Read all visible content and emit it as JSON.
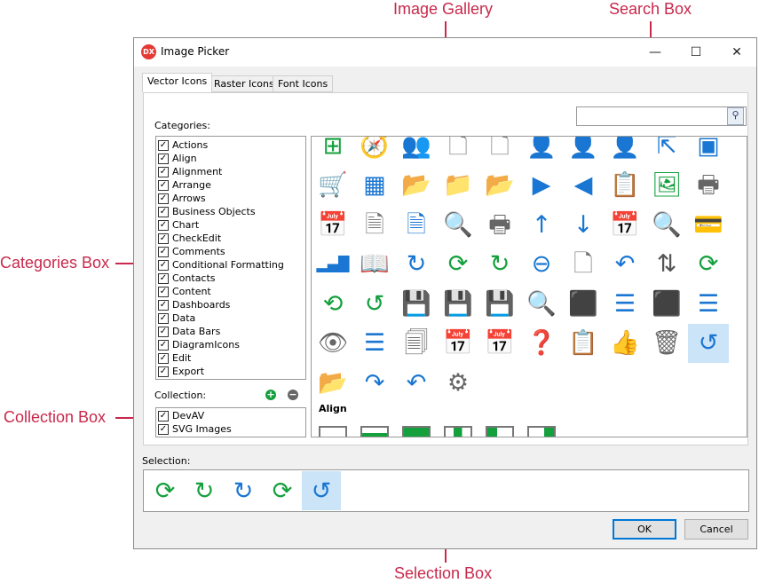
{
  "annotations": {
    "gallery": "Image Gallery",
    "search": "Search Box",
    "categories": "Categories Box",
    "collection": "Collection Box",
    "selection": "Selection Box",
    "color": "#c8294c"
  },
  "window": {
    "title": "Image Picker",
    "logo": "DX",
    "minimize": "—",
    "maximize": "☐",
    "close": "✕"
  },
  "tabs": [
    {
      "label": "Vector Icons",
      "active": true
    },
    {
      "label": "Raster Icons"
    },
    {
      "label": "Font Icons"
    }
  ],
  "categories_label": "Categories:",
  "categories": [
    "Actions",
    "Align",
    "Alignment",
    "Arrange",
    "Arrows",
    "Business Objects",
    "Chart",
    "CheckEdit",
    "Comments",
    "Conditional Formatting",
    "Contacts",
    "Content",
    "Dashboards",
    "Data",
    "Data Bars",
    "DiagramIcons",
    "Edit",
    "Export"
  ],
  "collection_label": "Collection:",
  "collection": [
    "DevAV",
    "SVG Images"
  ],
  "search": {
    "value": "",
    "icon": "magnifier-icon"
  },
  "gallery": {
    "icons": [
      {
        "name": "add-group-icon",
        "g": "⊞",
        "c": "#14a03c"
      },
      {
        "name": "compass-icon",
        "g": "🧭",
        "c": "#777"
      },
      {
        "name": "users-icon",
        "g": "👥",
        "c": "#777"
      },
      {
        "name": "blank-page-icon",
        "g": "🗋",
        "c": "#777"
      },
      {
        "name": "blank-page-icon",
        "g": "🗋",
        "c": "#777"
      },
      {
        "name": "add-user-icon",
        "g": "👤",
        "c": "#14a03c"
      },
      {
        "name": "user-icon",
        "g": "👤",
        "c": "#1976d2"
      },
      {
        "name": "user-more-icon",
        "g": "👤",
        "c": "#666"
      },
      {
        "name": "resize-picture-icon",
        "g": "⇱",
        "c": "#1976d2"
      },
      {
        "name": "add-window-icon",
        "g": "▣",
        "c": "#1976d2"
      },
      {
        "name": "add-to-cart-icon",
        "g": "🛒",
        "c": "#d32f2f"
      },
      {
        "name": "tiles-icon",
        "g": "▦",
        "c": "#1976d2"
      },
      {
        "name": "open-folder-icon",
        "g": "📂",
        "c": "#ffb300"
      },
      {
        "name": "folder-icon",
        "g": "📁",
        "c": "#ffb300"
      },
      {
        "name": "reload-folder-icon",
        "g": "📂",
        "c": "#ffb300"
      },
      {
        "name": "next-icon",
        "g": "▶",
        "c": "#1976d2"
      },
      {
        "name": "previous-icon",
        "g": "◀",
        "c": "#1976d2"
      },
      {
        "name": "paste-icon",
        "g": "📋",
        "c": "#ffb300"
      },
      {
        "name": "image-icon",
        "g": "🖼",
        "c": "#14a03c"
      },
      {
        "name": "printer-icon",
        "g": "🖶",
        "c": "#666"
      },
      {
        "name": "calendar-delete-icon",
        "g": "📅",
        "c": "#666"
      },
      {
        "name": "document-icon",
        "g": "🗎",
        "c": "#777"
      },
      {
        "name": "table-document-icon",
        "g": "🗎",
        "c": "#1976d2"
      },
      {
        "name": "zoom-page-icon",
        "g": "🔍",
        "c": "#777"
      },
      {
        "name": "quick-print-icon",
        "g": "🖶",
        "c": "#666"
      },
      {
        "name": "sort-ascending-icon",
        "g": "↑",
        "c": "#1976d2"
      },
      {
        "name": "sort-descending-icon",
        "g": "↓",
        "c": "#1976d2"
      },
      {
        "name": "calendar-clock-icon",
        "g": "📅",
        "c": "#666"
      },
      {
        "name": "preview-icon",
        "g": "🔍",
        "c": "#777"
      },
      {
        "name": "payment-icon",
        "g": "💳",
        "c": "#1976d2"
      },
      {
        "name": "bar-chart-icon",
        "g": "▂▄█",
        "c": "#1976d2"
      },
      {
        "name": "book-icon",
        "g": "📖",
        "c": "#777"
      },
      {
        "name": "redo-icon",
        "g": "↻",
        "c": "#1976d2"
      },
      {
        "name": "refresh-icon",
        "g": "⟳",
        "c": "#14a03c"
      },
      {
        "name": "refresh-all-icon",
        "g": "↻",
        "c": "#14a03c"
      },
      {
        "name": "remove-icon",
        "g": "⊖",
        "c": "#1976d2"
      },
      {
        "name": "remove-page-icon",
        "g": "🗋",
        "c": "#777"
      },
      {
        "name": "undo-icon",
        "g": "↶",
        "c": "#1976d2"
      },
      {
        "name": "swap-icon",
        "g": "⇅",
        "c": "#555"
      },
      {
        "name": "redo-green-icon",
        "g": "⟳",
        "c": "#14a03c"
      },
      {
        "name": "reset-icon",
        "g": "⟲",
        "c": "#14a03c"
      },
      {
        "name": "reset-all-icon",
        "g": "↺",
        "c": "#14a03c"
      },
      {
        "name": "save-icon",
        "g": "💾",
        "c": "#1976d2"
      },
      {
        "name": "save-close-icon",
        "g": "💾",
        "c": "#1976d2"
      },
      {
        "name": "save-more-icon",
        "g": "💾",
        "c": "#1976d2"
      },
      {
        "name": "find-icon",
        "g": "🔍",
        "c": "#1976d2"
      },
      {
        "name": "select-icon",
        "g": "⬛",
        "c": "#1976d2"
      },
      {
        "name": "select-all-icon",
        "g": "☰",
        "c": "#1976d2"
      },
      {
        "name": "select-icon",
        "g": "⬛",
        "c": "#1976d2"
      },
      {
        "name": "select-all-icon",
        "g": "☰",
        "c": "#1976d2"
      },
      {
        "name": "show-icon",
        "g": "👁",
        "c": "#666"
      },
      {
        "name": "list-icon",
        "g": "☰",
        "c": "#1976d2"
      },
      {
        "name": "sort-pages-icon",
        "g": "🗐",
        "c": "#666"
      },
      {
        "name": "calendar-down-icon",
        "g": "📅",
        "c": "#666"
      },
      {
        "name": "calendar-icon",
        "g": "📅",
        "c": "#666"
      },
      {
        "name": "help-icon",
        "g": "❓",
        "c": "#1976d2"
      },
      {
        "name": "task-icon",
        "g": "📋",
        "c": "#d32f2f"
      },
      {
        "name": "like-icon",
        "g": "👍",
        "c": "#ffb300"
      },
      {
        "name": "trash-icon",
        "g": "🗑",
        "c": "#666"
      },
      {
        "name": "undo-selected-icon",
        "g": "↺",
        "c": "#1976d2",
        "selected": true
      },
      {
        "name": "upload-folder-icon",
        "g": "📂",
        "c": "#ffb300"
      },
      {
        "name": "redo-arc-icon",
        "g": "↷",
        "c": "#1976d2"
      },
      {
        "name": "undo-arc-icon",
        "g": "↶",
        "c": "#1976d2"
      },
      {
        "name": "settings-icon",
        "g": "⚙",
        "c": "#666"
      }
    ],
    "next_group": "Align"
  },
  "selection_label": "Selection:",
  "selection": [
    {
      "name": "refresh-icon",
      "g": "⟳",
      "c": "#14a03c"
    },
    {
      "name": "refresh-all-icon",
      "g": "↻",
      "c": "#14a03c"
    },
    {
      "name": "redo-icon",
      "g": "↻",
      "c": "#1976d2"
    },
    {
      "name": "redo-green-icon",
      "g": "⟳",
      "c": "#14a03c"
    },
    {
      "name": "undo-icon",
      "g": "↺",
      "c": "#1976d2",
      "selected": true
    }
  ],
  "buttons": {
    "ok": "OK",
    "cancel": "Cancel"
  }
}
